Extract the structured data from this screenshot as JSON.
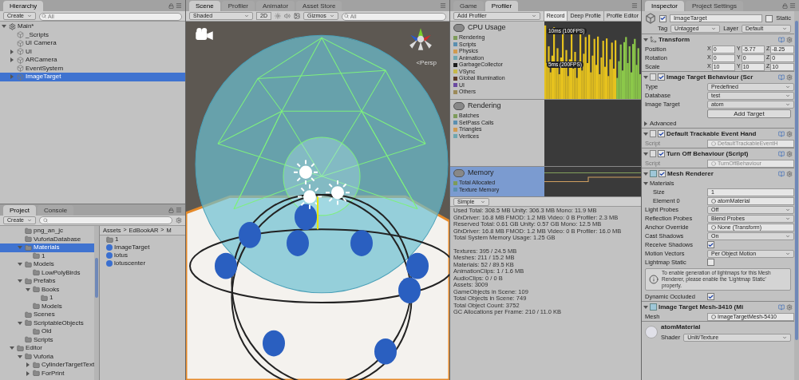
{
  "hierarchy": {
    "tabs": [
      {
        "label": "Hierarchy",
        "selected": true
      }
    ],
    "create": "Create",
    "search": {
      "placeholder": "All"
    },
    "tree": [
      {
        "label": "Main*",
        "kind": "scene",
        "expanded": true,
        "selected": false,
        "children": [
          {
            "label": "_Scripts",
            "kind": "object",
            "selected": false
          },
          {
            "label": "UI Camera",
            "kind": "object",
            "selected": false
          },
          {
            "label": "UI",
            "kind": "object",
            "expanded": false,
            "selected": false
          },
          {
            "label": "ARCamera",
            "kind": "object",
            "expanded": false,
            "selected": false
          },
          {
            "label": "EventSystem",
            "kind": "object",
            "selected": false
          },
          {
            "label": "ImageTarget",
            "kind": "object",
            "expanded": false,
            "selected": true
          }
        ]
      }
    ]
  },
  "project": {
    "tabs": [
      {
        "label": "Project",
        "selected": true
      },
      {
        "label": "Console",
        "selected": false
      }
    ],
    "create": "Create",
    "tree": [
      {
        "label": "png_an_jc",
        "kind": "folder",
        "selected": false
      },
      {
        "label": "VuforiaDatabase",
        "kind": "folder",
        "selected": false
      },
      {
        "label": "Materials",
        "kind": "folder",
        "expanded": true,
        "selected": true,
        "children": [
          {
            "label": "1",
            "kind": "folder",
            "selected": false
          }
        ]
      },
      {
        "label": "Models",
        "kind": "folder",
        "expanded": true,
        "selected": false,
        "children": [
          {
            "label": "LowPolyBirds",
            "kind": "folder",
            "selected": false
          }
        ]
      },
      {
        "label": "Prefabs",
        "kind": "folder",
        "expanded": true,
        "selected": false,
        "children": [
          {
            "label": "Books",
            "kind": "folder",
            "expanded": true,
            "selected": false,
            "children": [
              {
                "label": "1",
                "kind": "folder",
                "selected": false
              }
            ]
          },
          {
            "label": "Models",
            "kind": "folder",
            "selected": false
          }
        ]
      },
      {
        "label": "Scenes",
        "kind": "folder",
        "selected": false
      },
      {
        "label": "ScriptableObjects",
        "kind": "folder",
        "expanded": true,
        "selected": false,
        "children": [
          {
            "label": "Old",
            "kind": "folder",
            "selected": false
          }
        ]
      },
      {
        "label": "Scripts",
        "kind": "folder",
        "selected": false
      }
    ],
    "tree2": [
      {
        "label": "Editor",
        "kind": "folder",
        "expanded": true,
        "selected": false,
        "children": [
          {
            "label": "Vuforia",
            "kind": "folder",
            "expanded": true,
            "selected": false,
            "children": [
              {
                "label": "CylinderTargetText",
                "kind": "folder",
                "expanded": false,
                "selected": false
              },
              {
                "label": "ForPrint",
                "kind": "folder",
                "expanded": false,
                "selected": false
              }
            ]
          }
        ]
      }
    ],
    "breadcrumb": [
      {
        "kind": "link",
        "text": "Assets"
      },
      {
        "kind": "separator",
        "text": ">"
      },
      {
        "kind": "link",
        "text": "EdBookAR"
      },
      {
        "kind": "separator",
        "text": ">"
      },
      {
        "kind": "link",
        "text": "M"
      }
    ],
    "files": [
      {
        "label": "1",
        "kind": "folder"
      },
      {
        "label": "ImageTarget",
        "kind": "material"
      },
      {
        "label": "lotus",
        "kind": "material"
      },
      {
        "label": "lotuscenter",
        "kind": "material"
      }
    ]
  },
  "scene": {
    "tabs": [
      {
        "label": "Scene",
        "selected": true
      },
      {
        "label": "Profiler",
        "selected": false
      },
      {
        "label": "Animator",
        "selected": false
      },
      {
        "label": "Asset Store",
        "selected": false
      }
    ],
    "shading": "Shaded",
    "mode_2d": "2D",
    "gizmos": "Gizmos",
    "search": {
      "placeholder": "All"
    },
    "projection": "<Persp"
  },
  "profiler": {
    "tabs": [
      {
        "label": "Game",
        "selected": false
      },
      {
        "label": "Profiler",
        "selected": true
      }
    ],
    "add": "Add Profiler",
    "buttons": [
      {
        "label": "Record",
        "selected": true
      },
      {
        "label": "Deep Profile",
        "selected": false
      },
      {
        "label": "Profile Editor",
        "selected": false
      }
    ],
    "areas": [
      {
        "kind": "cpu",
        "title": "CPU Usage",
        "selected": false,
        "labels": [
          "10ms (100FPS)",
          "5ms (200FPS)"
        ],
        "items": [
          {
            "label": "Rendering",
            "color": "#7d9b5a"
          },
          {
            "label": "Scripts",
            "color": "#5a8fb0"
          },
          {
            "label": "Physics",
            "color": "#d09a50"
          },
          {
            "label": "Animation",
            "color": "#6fa6b0"
          },
          {
            "label": "GarbageCollector",
            "color": "#1c1c1c"
          },
          {
            "label": "VSync",
            "color": "#c6b84a"
          },
          {
            "label": "Global Illumination",
            "color": "#5a3a2a"
          },
          {
            "label": "UI",
            "color": "#6a4aa0"
          },
          {
            "label": "Others",
            "color": "#9b8a5a"
          }
        ]
      },
      {
        "kind": "rendering",
        "title": "Rendering",
        "selected": false,
        "items": [
          {
            "label": "Batches",
            "color": "#7d9b5a"
          },
          {
            "label": "SetPass Calls",
            "color": "#5a8fb0"
          },
          {
            "label": "Triangles",
            "color": "#d09a50"
          },
          {
            "label": "Vertices",
            "color": "#6fa6b0"
          }
        ]
      },
      {
        "kind": "memory",
        "title": "Memory",
        "selected": true,
        "items": [
          {
            "label": "Total Allocated",
            "color": "#7d9b5a"
          },
          {
            "label": "Texture Memory",
            "color": "#5a8fb0"
          }
        ]
      }
    ],
    "view": "Simple",
    "stats": [
      "Used Total: 308.5 MB   Unity: 306.3 MB   Mono: 11.9 MB",
      "GfxDriver: 16.8 MB   FMOD: 1.2 MB   Video: 0 B   Profiler: 2.3 MB",
      "Reserved Total: 0.61 GB   Unity: 0.57 GB   Mono: 12.5 MB",
      "GfxDriver: 16.8 MB   FMOD: 1.2 MB   Video: 0 B   Profiler: 16.0 MB",
      "Total System Memory Usage: 1.25 GB"
    ],
    "stats2": [
      "Textures: 395 / 24.5 MB",
      "Meshes: 211 / 15.2 MB",
      "Materials: 52 / 89.5 KB",
      "AnimationClips: 1 / 1.6 MB",
      "AudioClips: 0 / 0 B",
      "Assets: 3009",
      "GameObjects in Scene: 109",
      "Total Objects in Scene: 749",
      "Total Object Count: 3752",
      "GC Allocations per Frame: 210 / 11.0 KB"
    ]
  },
  "inspector": {
    "tabs": [
      {
        "label": "Inspector",
        "selected": true
      },
      {
        "label": "Project Settings",
        "selected": false
      }
    ],
    "object": {
      "active": true,
      "name": "ImageTarget",
      "static_label": "Static",
      "static": false,
      "tag_label": "Tag",
      "tag": "Untagged",
      "layer_label": "Layer",
      "layer": "Default"
    },
    "components": [
      {
        "title": "Transform",
        "kind": "transform",
        "fields": [
          {
            "kind": "xyz",
            "label": "Position",
            "values": [
              {
                "axis": "X",
                "value": "0"
              },
              {
                "axis": "Y",
                "value": "-5.77"
              },
              {
                "axis": "Z",
                "value": "-8.25"
              }
            ]
          },
          {
            "kind": "xyz",
            "label": "Rotation",
            "values": [
              {
                "axis": "X",
                "value": "0"
              },
              {
                "axis": "Y",
                "value": "0"
              },
              {
                "axis": "Z",
                "value": "0"
              }
            ]
          },
          {
            "kind": "xyz",
            "label": "Scale",
            "values": [
              {
                "axis": "X",
                "value": "10"
              },
              {
                "axis": "Y",
                "value": "10"
              },
              {
                "axis": "Z",
                "value": "10"
              }
            ]
          }
        ]
      },
      {
        "title": "Image Target Behaviour (Scr",
        "kind": "script",
        "enabled": true,
        "fields": [
          {
            "kind": "dropdown",
            "label": "Type",
            "value": "Predefined"
          },
          {
            "kind": "dropdown",
            "label": "Database",
            "value": "test"
          },
          {
            "kind": "dropdown",
            "label": "Image Target",
            "value": "atom"
          },
          {
            "kind": "button",
            "label": "Add Target"
          },
          {
            "kind": "foldout",
            "label": "Advanced",
            "expanded": false
          }
        ]
      },
      {
        "title": "Default Trackable Event Hand",
        "kind": "script",
        "enabled": true,
        "fields": [
          {
            "kind": "object",
            "label": "Script",
            "value": "DefaultTrackableEventH",
            "disabled": true
          }
        ]
      },
      {
        "title": "Turn Off Behaviour (Script)",
        "kind": "script",
        "enabled": true,
        "fields": [
          {
            "kind": "object",
            "label": "Script",
            "value": "TurnOffBehaviour",
            "disabled": true
          }
        ]
      },
      {
        "title": "Mesh Renderer",
        "kind": "mesh",
        "enabled": true,
        "fields": [
          {
            "kind": "foldout",
            "label": "Materials",
            "expanded": true,
            "children": [
              {
                "kind": "text",
                "label": "Size",
                "value": "1"
              },
              {
                "kind": "object",
                "label": "Element 0",
                "value": "atomMaterial"
              }
            ]
          },
          {
            "kind": "dropdown",
            "label": "Light Probes",
            "value": "Off"
          },
          {
            "kind": "dropdown",
            "label": "Reflection Probes",
            "value": "Blend Probes"
          },
          {
            "kind": "object",
            "label": "Anchor Override",
            "value": "None (Transform)"
          },
          {
            "kind": "dropdown",
            "label": "Cast Shadows",
            "value": "On"
          },
          {
            "kind": "check",
            "label": "Receive Shadows",
            "checked": true
          },
          {
            "kind": "dropdown",
            "label": "Motion Vectors",
            "value": "Per Object Motion"
          },
          {
            "kind": "check",
            "label": "Lightmap Static",
            "checked": false
          },
          {
            "kind": "help",
            "label": "To enable generation of lightmaps for this Mesh Renderer, please enable the 'Lightmap Static' property."
          },
          {
            "kind": "check",
            "label": "Dynamic Occluded",
            "checked": true
          }
        ]
      },
      {
        "title": "Image Target Mesh-3410 (Mi",
        "kind": "filter",
        "fields": [
          {
            "kind": "object",
            "label": "Mesh",
            "value": "ImageTargetMesh-5410"
          }
        ]
      }
    ],
    "material": {
      "name": "atomMaterial",
      "shader_label": "Shader",
      "shader": "Unlit/Texture"
    }
  }
}
